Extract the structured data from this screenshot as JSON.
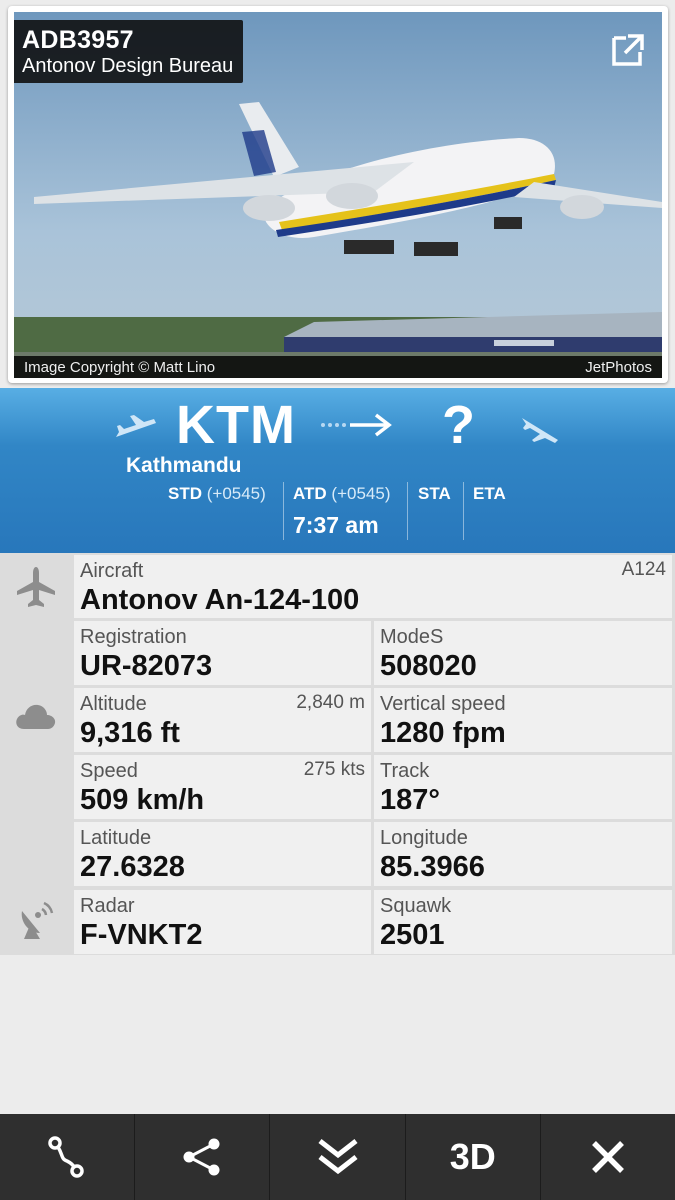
{
  "flight": {
    "callsign": "ADB3957",
    "airline": "Antonov Design Bureau"
  },
  "photo": {
    "copyright": "Image Copyright © Matt Lino",
    "source": "JetPhotos"
  },
  "route": {
    "origin_code": "KTM",
    "origin_name": "Kathmandu",
    "destination_code": "?",
    "std_label": "STD",
    "std_tz": "(+0545)",
    "atd_label": "ATD",
    "atd_tz": "(+0545)",
    "atd_time": "7:37 am",
    "sta_label": "STA",
    "eta_label": "ETA"
  },
  "details": {
    "aircraft": {
      "label": "Aircraft",
      "value": "Antonov An-124-100",
      "code": "A124"
    },
    "registration": {
      "label": "Registration",
      "value": "UR-82073"
    },
    "modes": {
      "label": "ModeS",
      "value": "508020"
    },
    "altitude": {
      "label": "Altitude",
      "value": "9,316 ft",
      "alt": "2,840 m"
    },
    "vertical_speed": {
      "label": "Vertical speed",
      "value": "1280 fpm"
    },
    "speed": {
      "label": "Speed",
      "value": "509 km/h",
      "alt": "275 kts"
    },
    "track": {
      "label": "Track",
      "value": "187°"
    },
    "latitude": {
      "label": "Latitude",
      "value": "27.6328"
    },
    "longitude": {
      "label": "Longitude",
      "value": "85.3966"
    },
    "radar": {
      "label": "Radar",
      "value": "F-VNKT2"
    },
    "squawk": {
      "label": "Squawk",
      "value": "2501"
    }
  },
  "toolbar": {
    "btn_3d": "3D",
    "icons": [
      "route-icon",
      "share-icon",
      "collapse-icon",
      "3d-view",
      "close-icon"
    ]
  },
  "colors": {
    "route_header": "#2f80c3",
    "toolbar": "#2f2f2f",
    "detail_cell": "#f0f0f0"
  }
}
